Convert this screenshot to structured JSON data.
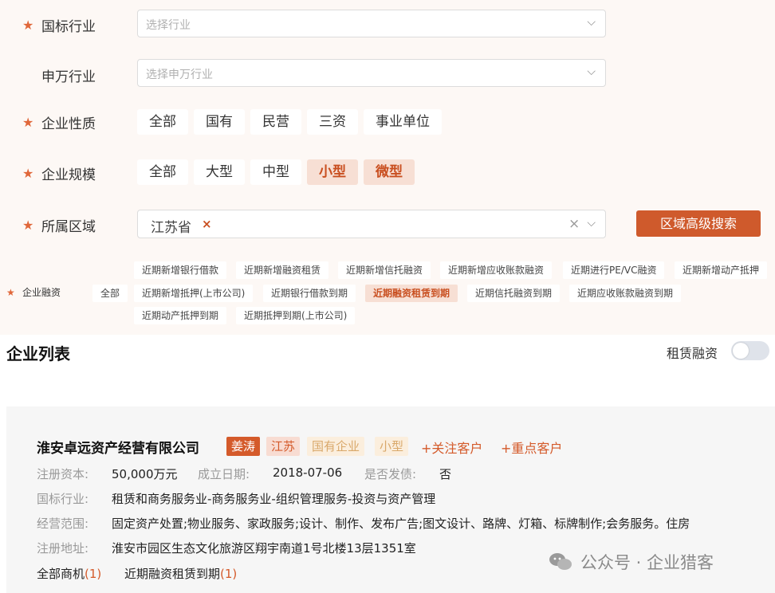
{
  "filters": {
    "industry": {
      "label": "国标行业",
      "placeholder": "选择行业"
    },
    "sw_industry": {
      "label": "申万行业",
      "placeholder": "选择申万行业"
    },
    "nature": {
      "label": "企业性质",
      "options": [
        "全部",
        "国有",
        "民营",
        "三资",
        "事业单位"
      ]
    },
    "scale": {
      "label": "企业规模",
      "options": [
        "全部",
        "大型",
        "中型",
        "小型",
        "微型"
      ],
      "selected": [
        "小型",
        "微型"
      ]
    },
    "region": {
      "label": "所属区域",
      "value": "江苏省",
      "remove": "×",
      "clear": "×",
      "search_button": "区域高级搜索"
    },
    "finance": {
      "label": "企业融资",
      "all": "全部",
      "row1": [
        "近期新增银行借款",
        "近期新增融资租赁",
        "近期新增信托融资",
        "近期新增应收账款融资",
        "近期进行PE/VC融资",
        "近期新增动产抵押"
      ],
      "row2": [
        "近期新增抵押(上市公司)",
        "近期银行借款到期",
        "近期融资租赁到期",
        "近期信托融资到期",
        "近期应收账款融资到期"
      ],
      "row3": [
        "近期动产抵押到期",
        "近期抵押到期(上市公司)"
      ],
      "selected": "近期融资租赁到期"
    }
  },
  "list": {
    "title": "企业列表",
    "toggle_label": "租赁融资",
    "company": {
      "name": "淮安卓远资产经营有限公司",
      "person": "姜涛",
      "province": "江苏",
      "type": "国有企业",
      "size": "小型",
      "follow": "+关注客户",
      "key": "+重点客户",
      "capital_label": "注册资本:",
      "capital": "50,000万元",
      "date_label": "成立日期:",
      "date": "2018-07-06",
      "bond_label": "是否发债:",
      "bond": "否",
      "industry_label": "国标行业:",
      "industry": "租赁和商务服务业-商务服务业-组织管理服务-投资与资产管理",
      "scope_label": "经营范围:",
      "scope": "固定资产处置;物业服务、家政服务;设计、制作、发布广告;图文设计、路牌、灯箱、标牌制作;会务服务。住房",
      "address_label": "注册地址:",
      "address": "淮安市园区生态文化旅游区翔宇南道1号北楼13层1351室",
      "opp_all": "全部商机",
      "opp_all_count": "(1)",
      "opp_lease": "近期融资租赁到期",
      "opp_lease_count": "(1)"
    }
  },
  "watermark": "公众号 · 企业猎客",
  "colors": {
    "accent": "#cf5a2c",
    "active_bg": "#f7dfd4"
  }
}
